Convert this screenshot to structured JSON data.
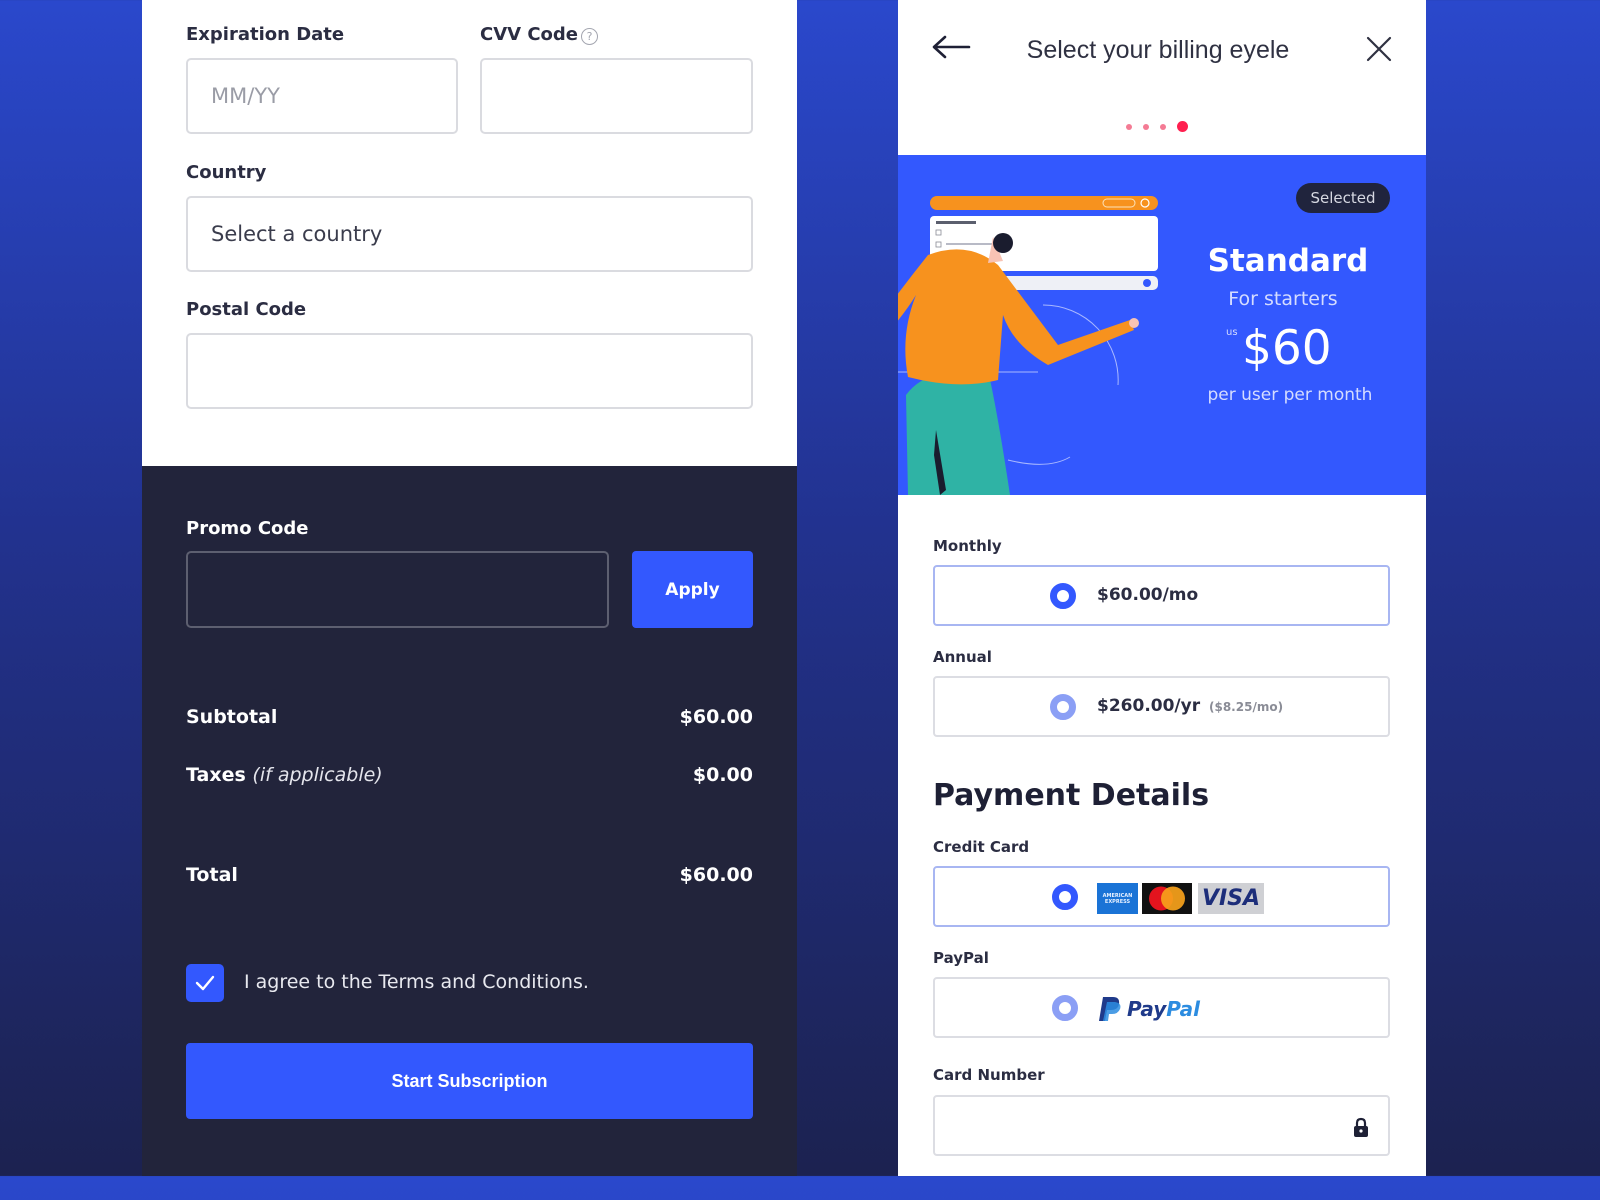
{
  "left": {
    "expiration": {
      "label": "Expiration Date",
      "placeholder": "MM/YY"
    },
    "cvv": {
      "label": "CVV Code",
      "help_glyph": "?",
      "value": ""
    },
    "country": {
      "label": "Country",
      "value": "Select a country"
    },
    "postal": {
      "label": "Postal Code",
      "value": ""
    },
    "promo": {
      "label": "Promo Code",
      "value": "",
      "apply_label": "Apply"
    },
    "summary": {
      "subtotal_label": "Subtotal",
      "subtotal_value": "$60.00",
      "taxes_label": "Taxes",
      "taxes_note": "(if applicable)",
      "taxes_value": "$0.00",
      "total_label": "Total",
      "total_value": "$60.00"
    },
    "terms": {
      "checked": true,
      "label": "I agree to the Terms and Conditions."
    },
    "submit_label": "Start Subscription"
  },
  "right": {
    "title": "Select your billing eyele",
    "steps": {
      "total": 4,
      "current": 4
    },
    "plan": {
      "badge": "Selected",
      "name": "Standard",
      "subtitle": "For starters",
      "currency": "us",
      "price": "$60",
      "period": "per user per month"
    },
    "billing_options": [
      {
        "label": "Monthly",
        "price": "$60.00/mo",
        "note": "",
        "selected": true
      },
      {
        "label": "Annual",
        "price": "$260.00/yr",
        "note": "($8.25/mo)",
        "selected": false
      }
    ],
    "payment": {
      "heading": "Payment Details",
      "credit_card_label": "Credit Card",
      "card_logos": {
        "amex": "AMERICAN EXPRESS",
        "mastercard": "MasterCard",
        "visa": "VISA"
      },
      "paypal_label": "PayPal",
      "paypal_logo_part1": "Pay",
      "paypal_logo_part2": "Pal",
      "card_number_label": "Card Number",
      "card_number_value": ""
    }
  },
  "colors": {
    "accent": "#3358fe",
    "dark_panel": "#22243b",
    "step_active": "#ff1f4f"
  }
}
